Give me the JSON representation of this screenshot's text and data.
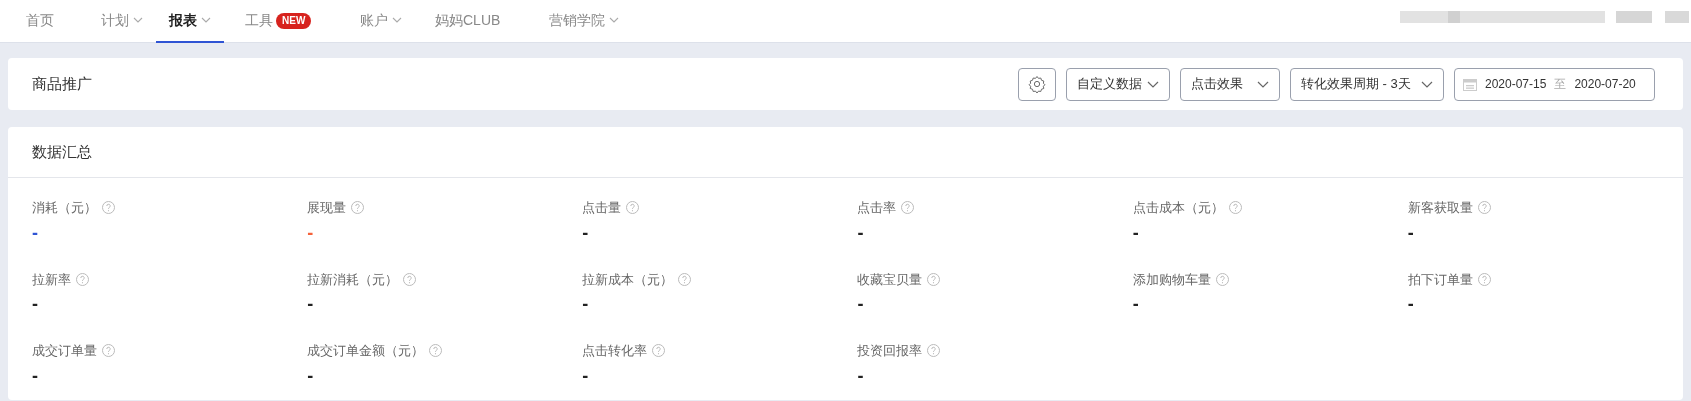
{
  "nav": {
    "items": [
      {
        "label": "首页",
        "selected": false,
        "dropdown": false
      },
      {
        "label": "计划",
        "selected": false,
        "dropdown": true
      },
      {
        "label": "报表",
        "selected": true,
        "dropdown": true
      },
      {
        "label": "工具",
        "selected": false,
        "dropdown": false,
        "badge": "NEW"
      },
      {
        "label": "账户",
        "selected": false,
        "dropdown": true
      },
      {
        "label": "妈妈CLUB",
        "selected": false,
        "dropdown": false
      },
      {
        "label": "营销学院",
        "selected": false,
        "dropdown": true
      }
    ]
  },
  "toolbar": {
    "title": "商品推广",
    "selects": [
      "自定义数据",
      "点击效果",
      "转化效果周期 - 3天"
    ],
    "date_range": {
      "start": "2020-07-15",
      "separator": "至",
      "end": "2020-07-20"
    }
  },
  "summary": {
    "title": "数据汇总",
    "metrics": [
      {
        "label": "消耗（元）",
        "value": "-",
        "color": "#2f54d4"
      },
      {
        "label": "展现量",
        "value": "-",
        "color": "#f5623a"
      },
      {
        "label": "点击量",
        "value": "-",
        "color": "#222222"
      },
      {
        "label": "点击率",
        "value": "-",
        "color": "#222222"
      },
      {
        "label": "点击成本（元）",
        "value": "-",
        "color": "#222222"
      },
      {
        "label": "新客获取量",
        "value": "-",
        "color": "#222222"
      },
      {
        "label": "拉新率",
        "value": "-",
        "color": "#222222"
      },
      {
        "label": "拉新消耗（元）",
        "value": "-",
        "color": "#222222"
      },
      {
        "label": "拉新成本（元）",
        "value": "-",
        "color": "#222222"
      },
      {
        "label": "收藏宝贝量",
        "value": "-",
        "color": "#222222"
      },
      {
        "label": "添加购物车量",
        "value": "-",
        "color": "#222222"
      },
      {
        "label": "拍下订单量",
        "value": "-",
        "color": "#222222"
      },
      {
        "label": "成交订单量",
        "value": "-",
        "color": "#222222"
      },
      {
        "label": "成交订单金额（元）",
        "value": "-",
        "color": "#222222"
      },
      {
        "label": "点击转化率",
        "value": "-",
        "color": "#222222"
      },
      {
        "label": "投资回报率",
        "value": "-",
        "color": "#222222"
      }
    ]
  }
}
